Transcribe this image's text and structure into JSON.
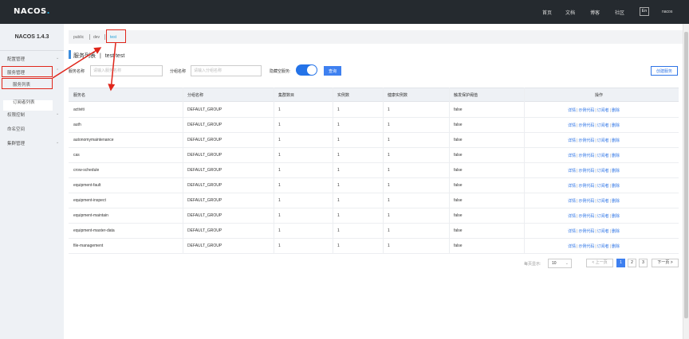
{
  "header": {
    "logo_text": "NACOS",
    "logo_dot": ".",
    "nav": [
      "首页",
      "文档",
      "博客",
      "社区"
    ],
    "lang": "En",
    "user": "nacos"
  },
  "sidebar": {
    "version": "NACOS 1.4.3",
    "items": [
      {
        "label": "配置管理",
        "has_arrow": true
      },
      {
        "label": "服务管理",
        "has_arrow": true
      },
      {
        "label": "服务列表",
        "has_arrow": false
      },
      {
        "label": "订阅者列表",
        "has_arrow": false
      },
      {
        "label": "权限控制",
        "has_arrow": true
      },
      {
        "label": "命名空间",
        "has_arrow": false
      },
      {
        "label": "集群管理",
        "has_arrow": true
      }
    ]
  },
  "breadcrumb": {
    "items": [
      "public",
      "dev",
      "test"
    ],
    "active_index": 2
  },
  "page": {
    "title": "服务列表",
    "separator": "|",
    "namespace": "test",
    "namespace_id": "test"
  },
  "filters": {
    "service_label": "服务名称",
    "service_placeholder": "请输入服务名称",
    "group_label": "分组名称",
    "group_placeholder": "请输入分组名称",
    "hide_empty_label": "隐藏空服务:",
    "hide_empty_on": true,
    "query_button": "查询",
    "create_button": "创建服务"
  },
  "table": {
    "columns": [
      "服务名",
      "分组名称",
      "集群数目",
      "实例数",
      "健康实例数",
      "触发保护阈值",
      "操作"
    ],
    "rows": [
      {
        "name": "activiti",
        "group": "DEFAULT_GROUP",
        "clusters": "1",
        "instances": "1",
        "healthy": "1",
        "protect": "false"
      },
      {
        "name": "auth",
        "group": "DEFAULT_GROUP",
        "clusters": "1",
        "instances": "1",
        "healthy": "1",
        "protect": "false"
      },
      {
        "name": "autonomymaintenance",
        "group": "DEFAULT_GROUP",
        "clusters": "1",
        "instances": "1",
        "healthy": "1",
        "protect": "false"
      },
      {
        "name": "cas",
        "group": "DEFAULT_GROUP",
        "clusters": "1",
        "instances": "1",
        "healthy": "1",
        "protect": "false"
      },
      {
        "name": "crow-schedule",
        "group": "DEFAULT_GROUP",
        "clusters": "1",
        "instances": "1",
        "healthy": "1",
        "protect": "false"
      },
      {
        "name": "equipment-fault",
        "group": "DEFAULT_GROUP",
        "clusters": "1",
        "instances": "1",
        "healthy": "1",
        "protect": "false"
      },
      {
        "name": "equipment-inspect",
        "group": "DEFAULT_GROUP",
        "clusters": "1",
        "instances": "1",
        "healthy": "1",
        "protect": "false"
      },
      {
        "name": "equipment-maintain",
        "group": "DEFAULT_GROUP",
        "clusters": "1",
        "instances": "1",
        "healthy": "1",
        "protect": "false"
      },
      {
        "name": "equipment-master-data",
        "group": "DEFAULT_GROUP",
        "clusters": "1",
        "instances": "1",
        "healthy": "1",
        "protect": "false"
      },
      {
        "name": "file-management",
        "group": "DEFAULT_GROUP",
        "clusters": "1",
        "instances": "1",
        "healthy": "1",
        "protect": "false"
      }
    ],
    "ops": [
      "详情",
      "示例代码",
      "订阅者",
      "删除"
    ]
  },
  "pagination": {
    "page_size_label": "每页显示:",
    "page_size": "10",
    "prev": "< 上一页",
    "pages": [
      "1",
      "2",
      "3"
    ],
    "current": "1",
    "next": "下一页 >"
  },
  "colors": {
    "topbar": "#252a2f",
    "accent": "#3e80f0",
    "annotation": "#e0261b"
  }
}
